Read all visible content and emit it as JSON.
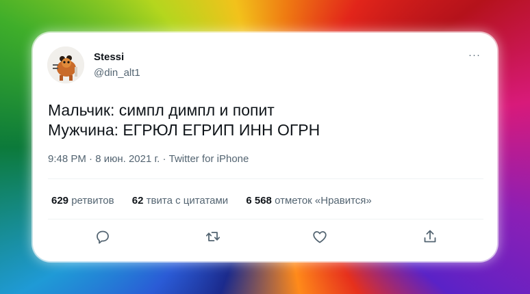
{
  "tweet": {
    "display_name": "Stessi",
    "handle": "@din_alt1",
    "more_label": "···",
    "text_line1": "Мальчик: симпл димпл и попит",
    "text_line2": "Мужчина: ЕГРЮЛ ЕГРИП ИНН ОГРН",
    "timestamp": "9:48 PM · 8 июн. 2021 г. · Twitter for iPhone"
  },
  "stats": {
    "retweets_count": "629",
    "retweets_label": "ретвитов",
    "quotes_count": "62",
    "quotes_label": "твита с цитатами",
    "likes_count": "6 568",
    "likes_label": "отметок «Нравится»"
  },
  "actions": {
    "reply_icon": "reply-icon",
    "retweet_icon": "retweet-icon",
    "like_icon": "like-icon",
    "share_icon": "share-icon"
  },
  "colors": {
    "text_primary": "#0f1419",
    "text_secondary": "#536471",
    "card_background": "#ffffff",
    "divider": "#eff3f4"
  }
}
